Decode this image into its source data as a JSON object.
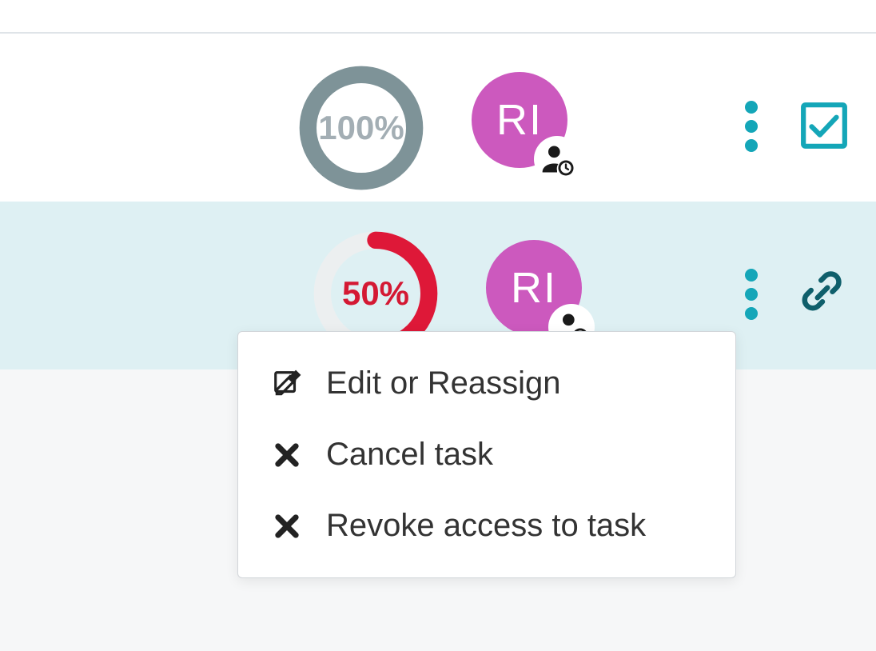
{
  "rows": [
    {
      "progress_label": "100%",
      "progress_value": 100,
      "avatar_initials": "RI",
      "color_ring": "#7e9398",
      "right_icon": "checkbox"
    },
    {
      "progress_label": "50%",
      "progress_value": 50,
      "avatar_initials": "RI",
      "color_ring": "#de1838",
      "right_icon": "link"
    }
  ],
  "menu": {
    "edit": "Edit or Reassign",
    "cancel": "Cancel task",
    "revoke": "Revoke access to task"
  },
  "colors": {
    "teal": "#14a6b8",
    "avatar": "#cc59be",
    "row_highlight": "#def0f3"
  }
}
